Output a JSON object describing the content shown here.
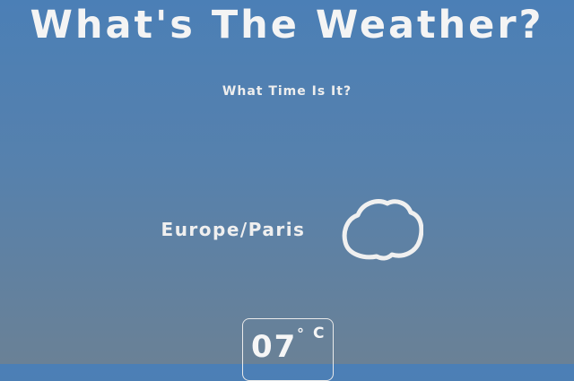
{
  "header": {
    "title": "What's The Weather?",
    "time_link": "What Time Is It?"
  },
  "location": {
    "name": "Europe/Paris"
  },
  "weather": {
    "icon": "cloud-icon",
    "temperature": "07",
    "degree_symbol": "°",
    "unit": "C"
  },
  "colors": {
    "background_top": "#4b7fb6",
    "background_bottom": "#6a8196",
    "text": "#f2f2f2"
  }
}
